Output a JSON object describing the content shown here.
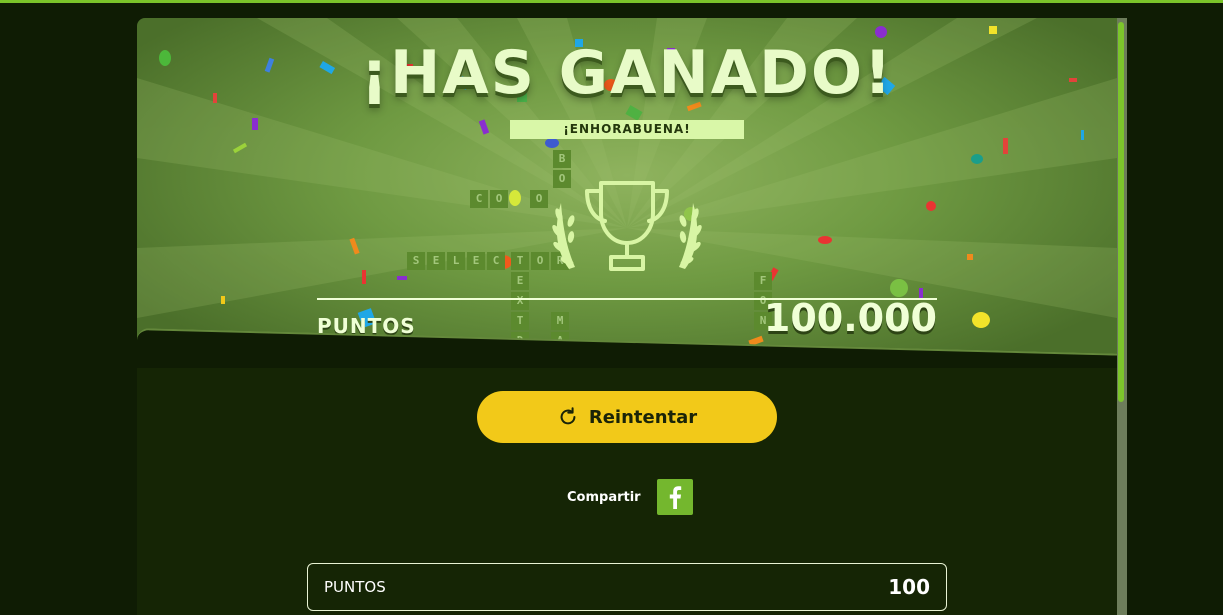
{
  "hero": {
    "title": "¡HAS GANADO!",
    "subtitle": "¡ENHORABUENA!",
    "points_label": "PUNTOS",
    "points_value": "100.000",
    "board_tiles": [
      "C",
      "O",
      "O",
      "B",
      "O",
      "S",
      "E",
      "L",
      "E",
      "C",
      "T",
      "O",
      "R",
      "E",
      "X",
      "T",
      "D",
      "M",
      "A",
      "F",
      "O",
      "N"
    ]
  },
  "actions": {
    "retry_label": "Reintentar",
    "share_label": "Compartir"
  },
  "score": {
    "label": "PUNTOS",
    "value": "100"
  },
  "colors": {
    "accent": "#7bc42a",
    "retry_button": "#f2c919",
    "facebook": "#74b72e",
    "background": "#0f1c04"
  },
  "icons": {
    "retry": "refresh-icon",
    "share": "facebook-icon",
    "trophy": "trophy-icon"
  }
}
